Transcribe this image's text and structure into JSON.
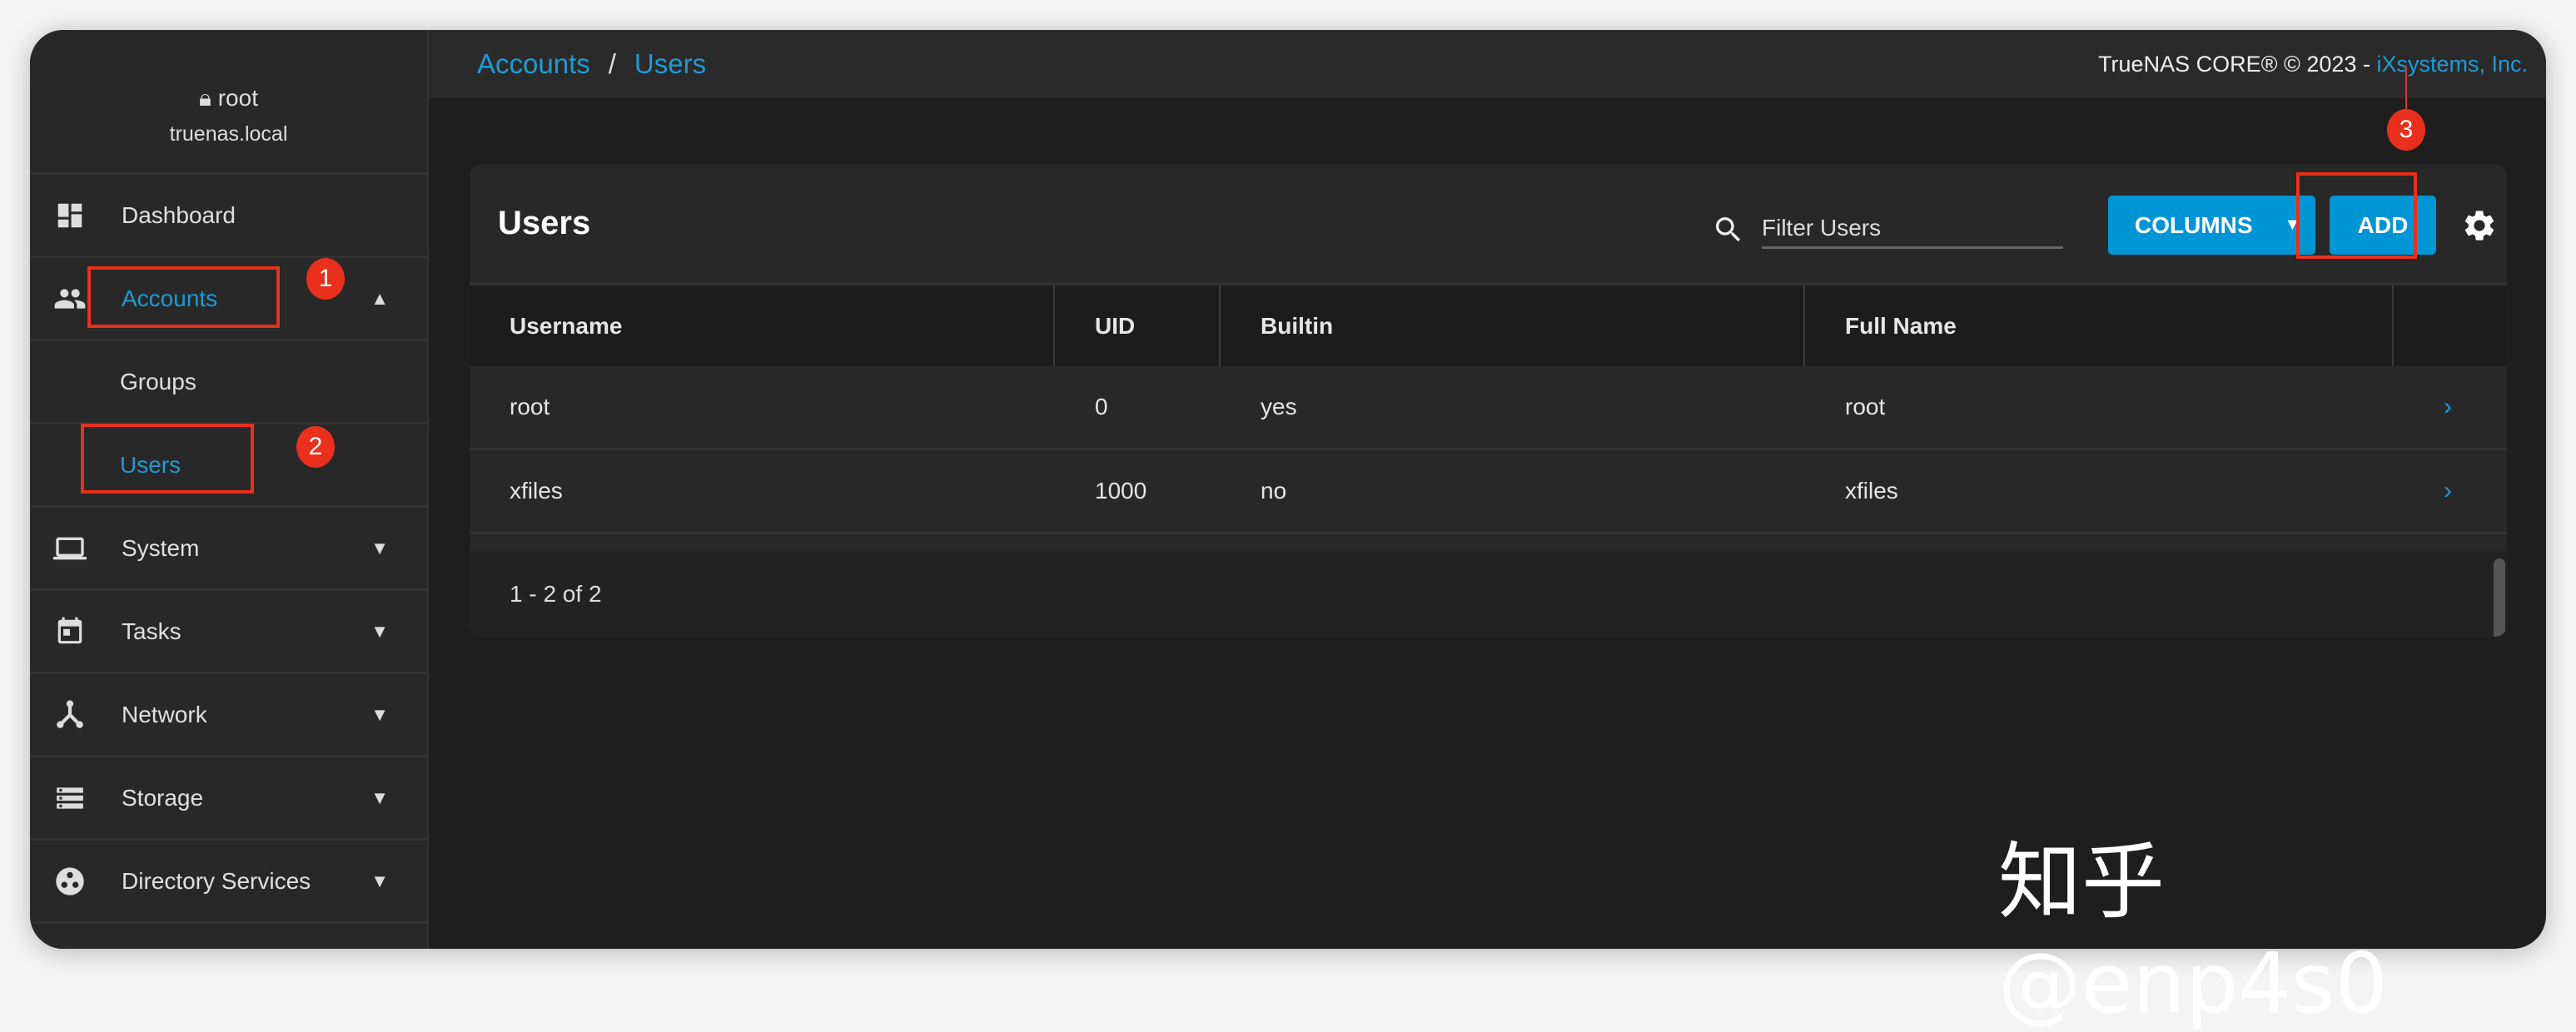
{
  "sidebar": {
    "user": "root",
    "host": "truenas.local",
    "items": [
      {
        "label": "Dashboard",
        "icon": "dashboard-icon"
      },
      {
        "label": "Accounts",
        "icon": "people-icon",
        "expanded": true,
        "active": true
      },
      {
        "label": "Groups",
        "sub": true
      },
      {
        "label": "Users",
        "sub": true,
        "active": true
      },
      {
        "label": "System",
        "icon": "laptop-icon"
      },
      {
        "label": "Tasks",
        "icon": "calendar-icon"
      },
      {
        "label": "Network",
        "icon": "network-icon"
      },
      {
        "label": "Storage",
        "icon": "storage-icon"
      },
      {
        "label": "Directory Services",
        "icon": "directory-icon"
      }
    ]
  },
  "header": {
    "breadcrumb": [
      "Accounts",
      "Users"
    ],
    "copyright": "TrueNAS CORE® © 2023 - ",
    "company": "iXsystems, Inc."
  },
  "card": {
    "title": "Users",
    "search_placeholder": "Filter Users",
    "columns_label": "COLUMNS",
    "add_label": "ADD",
    "columns": [
      "Username",
      "UID",
      "Builtin",
      "Full Name"
    ],
    "rows": [
      [
        "root",
        "0",
        "yes",
        "root"
      ],
      [
        "xfiles",
        "1000",
        "no",
        "xfiles"
      ]
    ],
    "pagination": "1 - 2 of 2"
  },
  "annotations": [
    "1",
    "2",
    "3"
  ],
  "watermark": "知乎 @enp4s0",
  "colors": {
    "accent": "#0095d5",
    "link": "#1e9ad6",
    "annotation": "#e8301c"
  }
}
